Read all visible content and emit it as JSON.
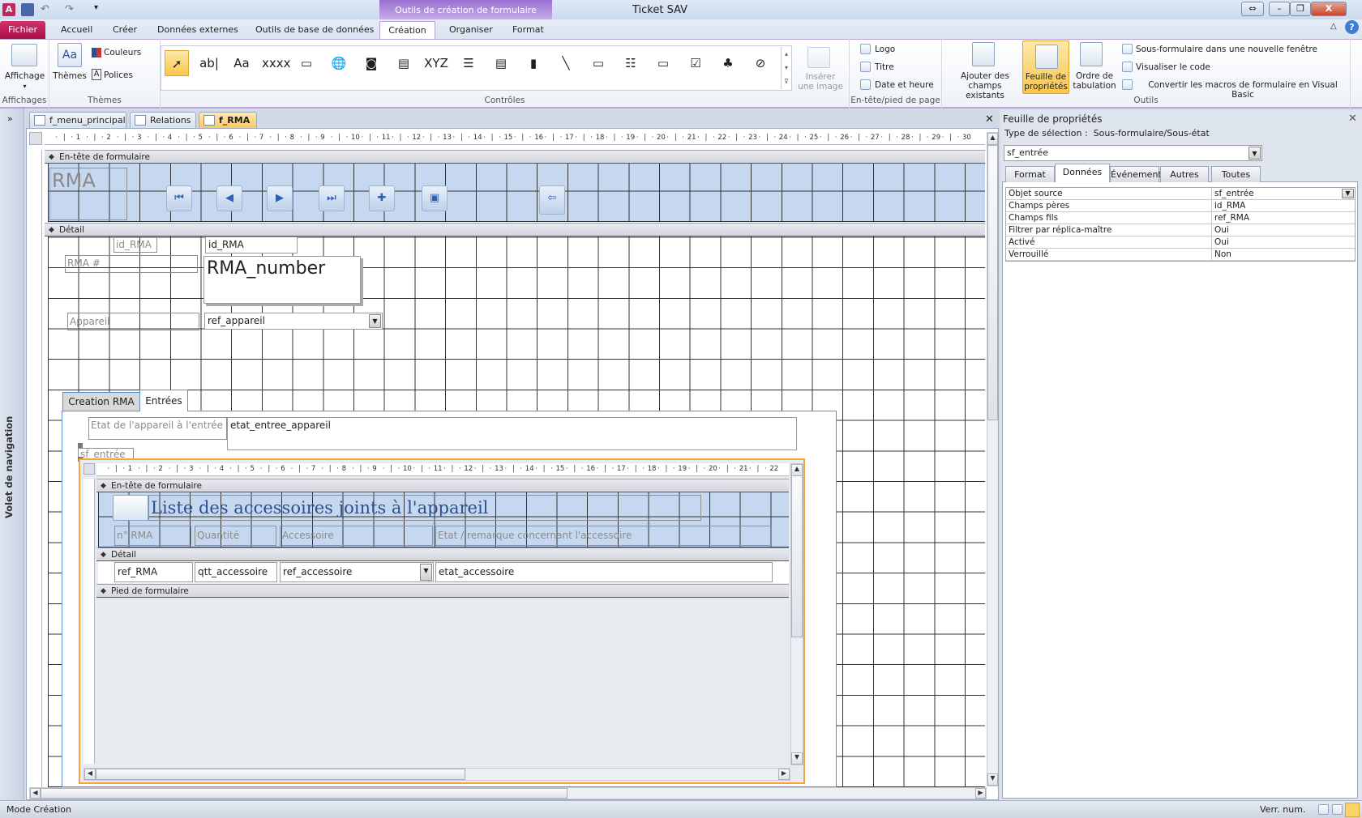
{
  "window": {
    "title": "Ticket SAV",
    "contextual_tab": "Outils de création de formulaire"
  },
  "ribbon_tabs": [
    "Fichier",
    "Accueil",
    "Créer",
    "Données externes",
    "Outils de base de données",
    "Création",
    "Organiser",
    "Format"
  ],
  "active_tab": "Création",
  "ribbon": {
    "affichages": {
      "label": "Affichages",
      "button": "Affichage"
    },
    "themes": {
      "label": "Thèmes",
      "themes_button": "Thèmes",
      "colors": "Couleurs",
      "fonts": "Polices"
    },
    "controles": {
      "label": "Contrôles",
      "insert_image": "Insérer une image",
      "icons": [
        "select-pointer-icon",
        "textbox-icon",
        "label-icon",
        "button-icon",
        "tab-control-icon",
        "hyperlink-icon",
        "web-browser-icon",
        "navigation-control-icon",
        "option-group-icon",
        "page-break-icon",
        "combo-box-icon",
        "chart-icon",
        "line-icon",
        "toggle-button-icon",
        "list-box-icon",
        "rectangle-icon",
        "checkbox-icon",
        "unbound-object-icon",
        "attachment-icon"
      ]
    },
    "entete": {
      "label": "En-tête/pied de page",
      "logo": "Logo",
      "titre": "Titre",
      "date": "Date et heure"
    },
    "outils": {
      "label": "Outils",
      "add_fields": "Ajouter des champs existants",
      "property_sheet": "Feuille de propriétés",
      "tab_order": "Ordre de tabulation",
      "subform_window": "Sous-formulaire dans une nouvelle fenêtre",
      "view_code": "Visualiser le code",
      "convert_macros": "Convertir les macros de formulaire en Visual Basic"
    }
  },
  "nav_pane": {
    "label": "Volet de navigation"
  },
  "doc_tabs": [
    "f_menu_principal",
    "Relations",
    "f_RMA"
  ],
  "form": {
    "ruler_max": 30,
    "header_section": "En-tête de formulaire",
    "detail_section": "Détail",
    "title_label": "RMA",
    "nav_buttons": [
      "first-record-icon",
      "previous-record-icon",
      "next-record-icon",
      "last-record-icon",
      "new-record-icon",
      "save-record-icon",
      "close-form-icon"
    ],
    "id_label": "id_RMA",
    "id_field": "id_RMA",
    "rma_label": "RMA #",
    "rma_field": "RMA_number",
    "appareil_label": "Appareil",
    "appareil_field": "ref_appareil",
    "tabs": [
      "Creation RMA",
      "Entrées"
    ],
    "etat_label": "Etat de l'appareil à l'entrée",
    "etat_field": "etat_entree_appareil",
    "subform_label": "sf_entrée",
    "subform": {
      "ruler_max": 22,
      "header_section": "En-tête de formulaire",
      "title": "Liste des accessoires joints à l'appareil",
      "columns": [
        "n° RMA",
        "Quantité",
        "Accessoire",
        "Etat / remarque concernant l'accessoire"
      ],
      "detail_section": "Détail",
      "fields": [
        "ref_RMA",
        "qtt_accessoire",
        "ref_accessoire",
        "etat_accessoire"
      ],
      "footer_section": "Pied de formulaire"
    }
  },
  "property_sheet": {
    "title": "Feuille de propriétés",
    "selection_type_label": "Type de sélection :",
    "selection_type": "Sous-formulaire/Sous-état",
    "selected_object": "sf_entrée",
    "tabs": [
      "Format",
      "Données",
      "Événement",
      "Autres",
      "Toutes"
    ],
    "active_tab": "Données",
    "rows": [
      {
        "name": "Objet source",
        "value": "sf_entrée"
      },
      {
        "name": "Champs pères",
        "value": "id_RMA"
      },
      {
        "name": "Champs fils",
        "value": "ref_RMA"
      },
      {
        "name": "Filtrer par réplica-maître",
        "value": "Oui"
      },
      {
        "name": "Activé",
        "value": "Oui"
      },
      {
        "name": "Verrouillé",
        "value": "Non"
      }
    ]
  },
  "status": {
    "mode": "Mode Création",
    "numlock": "Verr. num."
  },
  "colors": {
    "accent": "#a80f48",
    "contextual": "#9a6fd0",
    "selection": "#f7a33a",
    "header_band": "#c6d8ef"
  }
}
